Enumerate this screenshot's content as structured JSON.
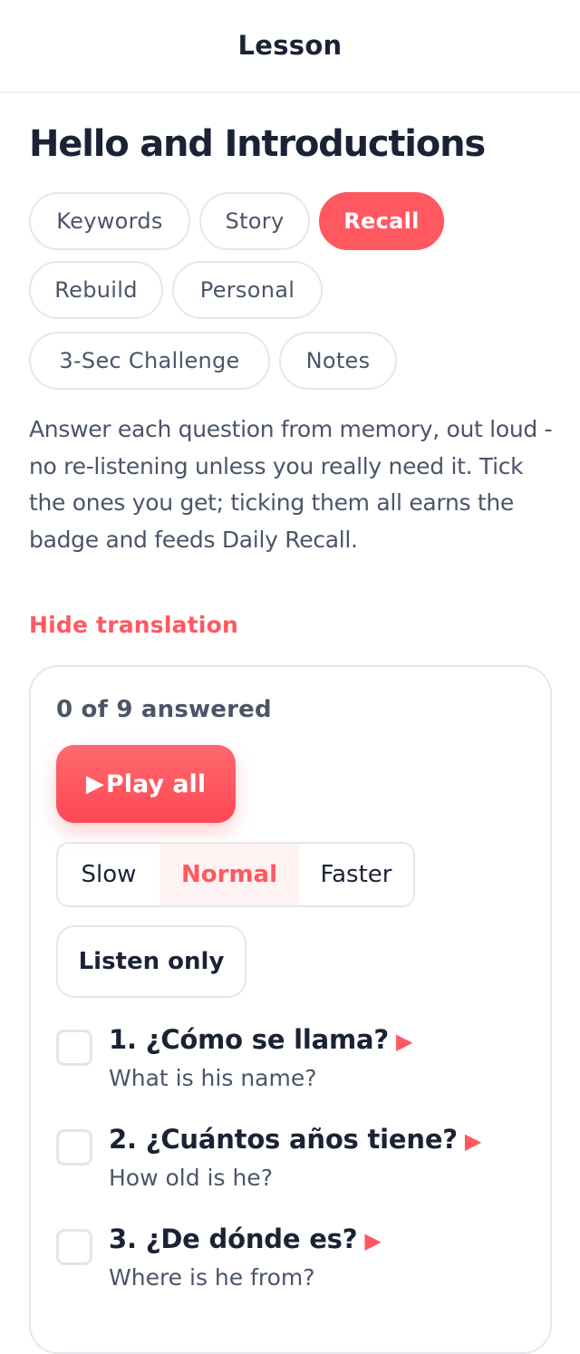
{
  "header": {
    "title": "Lesson"
  },
  "lesson": {
    "title": "Hello and Introductions"
  },
  "tabs": [
    {
      "label": "Keywords",
      "active": false
    },
    {
      "label": "Story",
      "active": false
    },
    {
      "label": "Recall",
      "active": true
    },
    {
      "label": "Rebuild",
      "active": false
    },
    {
      "label": "Personal",
      "active": false
    },
    {
      "label": "3-Sec Challenge",
      "active": false
    },
    {
      "label": "Notes",
      "active": false
    }
  ],
  "instructions": "Answer each question from memory, out loud - no re-listening unless you really need it. Tick the ones you get; ticking them all earns the badge and feeds Daily Recall.",
  "translation_toggle": "Hide translation",
  "recall": {
    "progress": "0 of 9 answered",
    "play_all": {
      "glyph": "▶",
      "label": "Play all"
    },
    "speeds": [
      {
        "label": "Slow",
        "selected": false
      },
      {
        "label": "Normal",
        "selected": true
      },
      {
        "label": "Faster",
        "selected": false
      }
    ],
    "listen_only": "Listen only",
    "questions": [
      {
        "text": "1. ¿Cómo se llama?",
        "translation": "What is his name?",
        "checked": false
      },
      {
        "text": "2. ¿Cuántos años tiene?",
        "translation": "How old is he?",
        "checked": false
      },
      {
        "text": "3. ¿De dónde es?",
        "translation": "Where is he from?",
        "checked": false
      }
    ],
    "play_glyph": "▶"
  },
  "colors": {
    "accent": "#ff5861",
    "text_primary": "#1b2236",
    "text_secondary": "#4b5568",
    "border": "#e5e7eb"
  }
}
